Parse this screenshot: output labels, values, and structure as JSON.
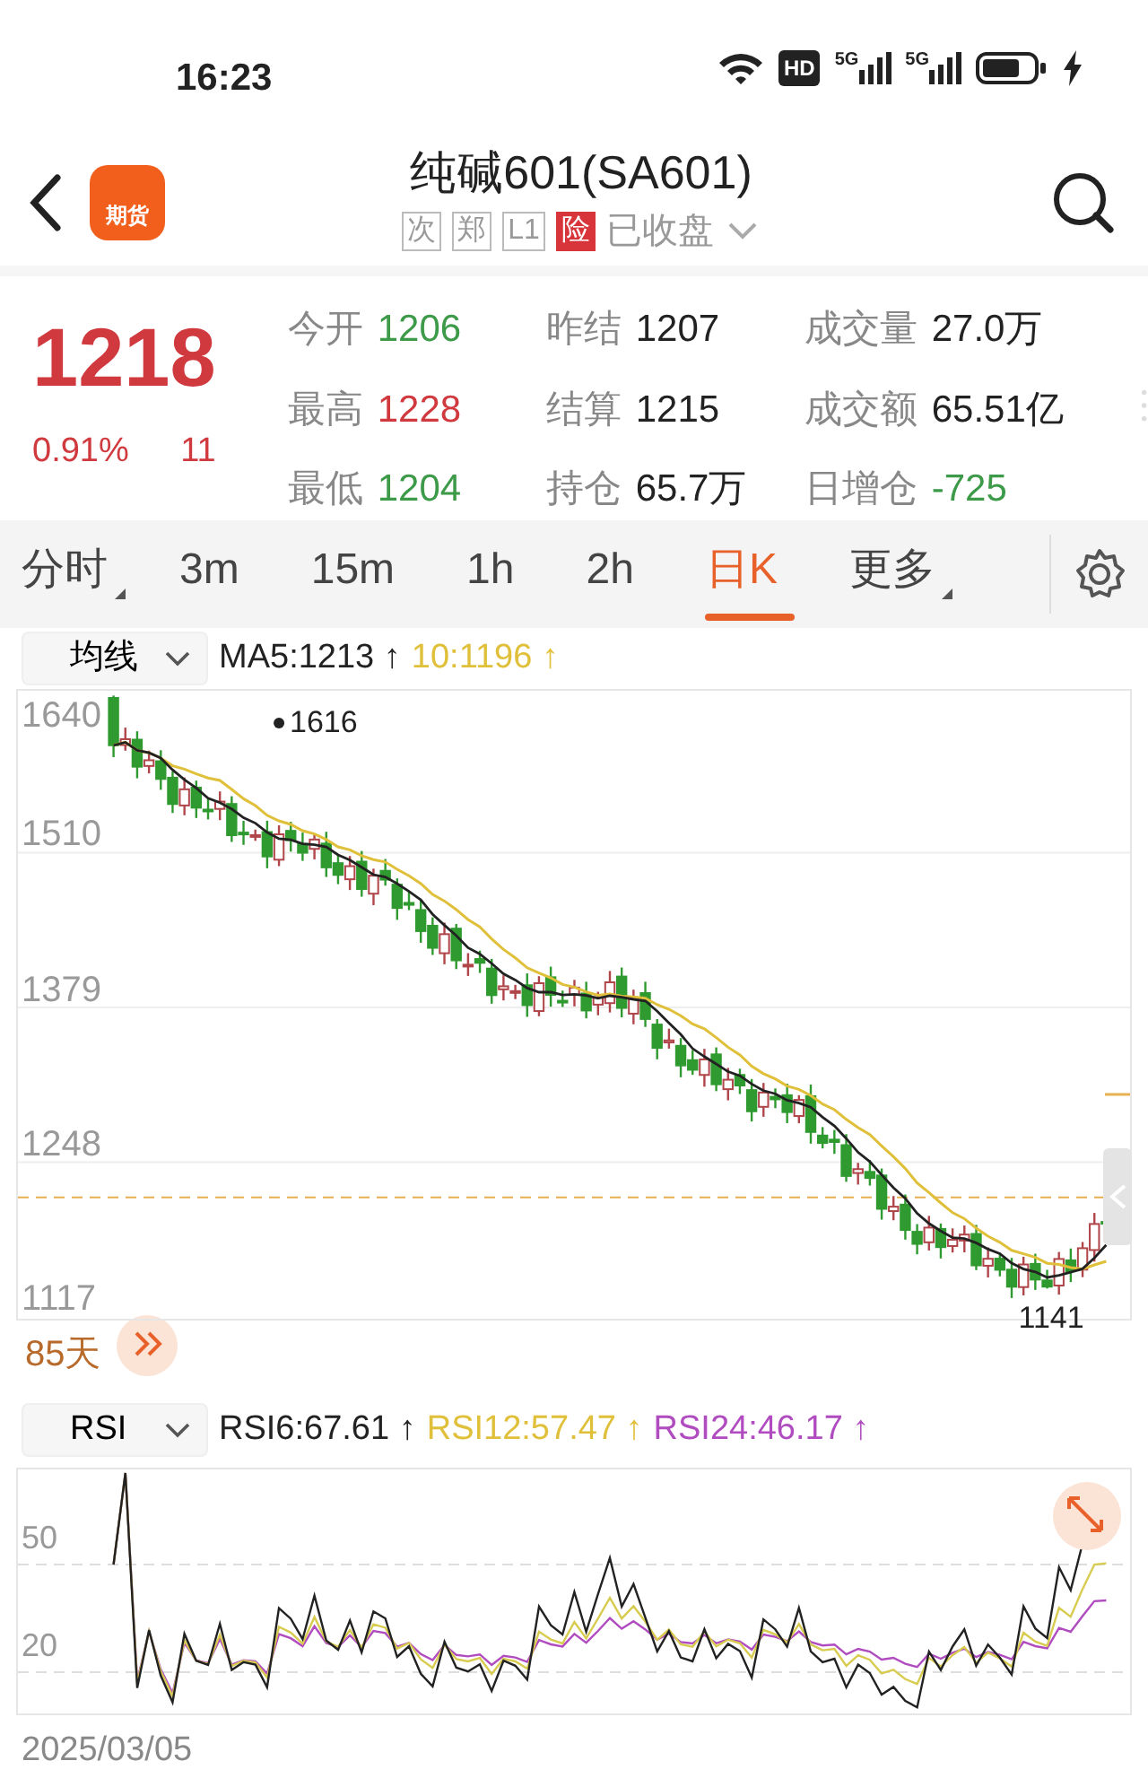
{
  "status_bar": {
    "time": "16:23",
    "hd_label": "HD",
    "network_labels": [
      "5G",
      "5G"
    ]
  },
  "header": {
    "app_label": "期货",
    "title": "纯碱601(SA601)",
    "tags": [
      {
        "text": "次",
        "kind": "outline"
      },
      {
        "text": "郑",
        "kind": "outline"
      },
      {
        "text": "L1",
        "kind": "outline"
      },
      {
        "text": "险",
        "kind": "filled"
      }
    ],
    "market_status": "已收盘"
  },
  "quote": {
    "price": "1218",
    "change_percent": "0.91%",
    "change": "11",
    "color": "#d0393e",
    "stats": [
      {
        "label": "今开",
        "value": "1206",
        "color": "#3c9a48"
      },
      {
        "label": "昨结",
        "value": "1207",
        "color": "#222222"
      },
      {
        "label": "成交量",
        "value": "27.0万",
        "color": "#222222"
      },
      {
        "label": "最高",
        "value": "1228",
        "color": "#d0393e"
      },
      {
        "label": "结算",
        "value": "1215",
        "color": "#222222"
      },
      {
        "label": "成交额",
        "value": "65.51亿",
        "color": "#222222"
      },
      {
        "label": "最低",
        "value": "1204",
        "color": "#3c9a48"
      },
      {
        "label": "持仓",
        "value": "65.7万",
        "color": "#222222"
      },
      {
        "label": "日增仓",
        "value": "-725",
        "color": "#3c9a48"
      }
    ]
  },
  "tabs": [
    {
      "label": "分时",
      "selected": false,
      "has_menu": true
    },
    {
      "label": "3m",
      "selected": false,
      "has_menu": false
    },
    {
      "label": "15m",
      "selected": false,
      "has_menu": false
    },
    {
      "label": "1h",
      "selected": false,
      "has_menu": false
    },
    {
      "label": "2h",
      "selected": false,
      "has_menu": false
    },
    {
      "label": "日K",
      "selected": true,
      "has_menu": false
    },
    {
      "label": "更多",
      "selected": false,
      "has_menu": true
    }
  ],
  "price_chart": {
    "indicator": "均线",
    "legend": [
      {
        "text": "MA5:1213 ↑",
        "color": "#222222"
      },
      {
        "text": "10:1196 ↑",
        "color": "#e0c03a"
      }
    ],
    "axis_labels": [
      "1640",
      "1510",
      "1379",
      "1248",
      "1117"
    ],
    "high_label": "1616",
    "low_label": "1141",
    "days": "85天"
  },
  "rsi_chart": {
    "indicator": "RSI",
    "legend": [
      {
        "text": "RSI6:67.61 ↑",
        "color": "#222222"
      },
      {
        "text": "RSI12:57.47 ↑",
        "color": "#e0c03a"
      },
      {
        "text": "RSI24:46.17 ↑",
        "color": "#b04cc0"
      }
    ],
    "axis_labels": [
      "50",
      "20"
    ],
    "date": "2025/03/05"
  }
}
